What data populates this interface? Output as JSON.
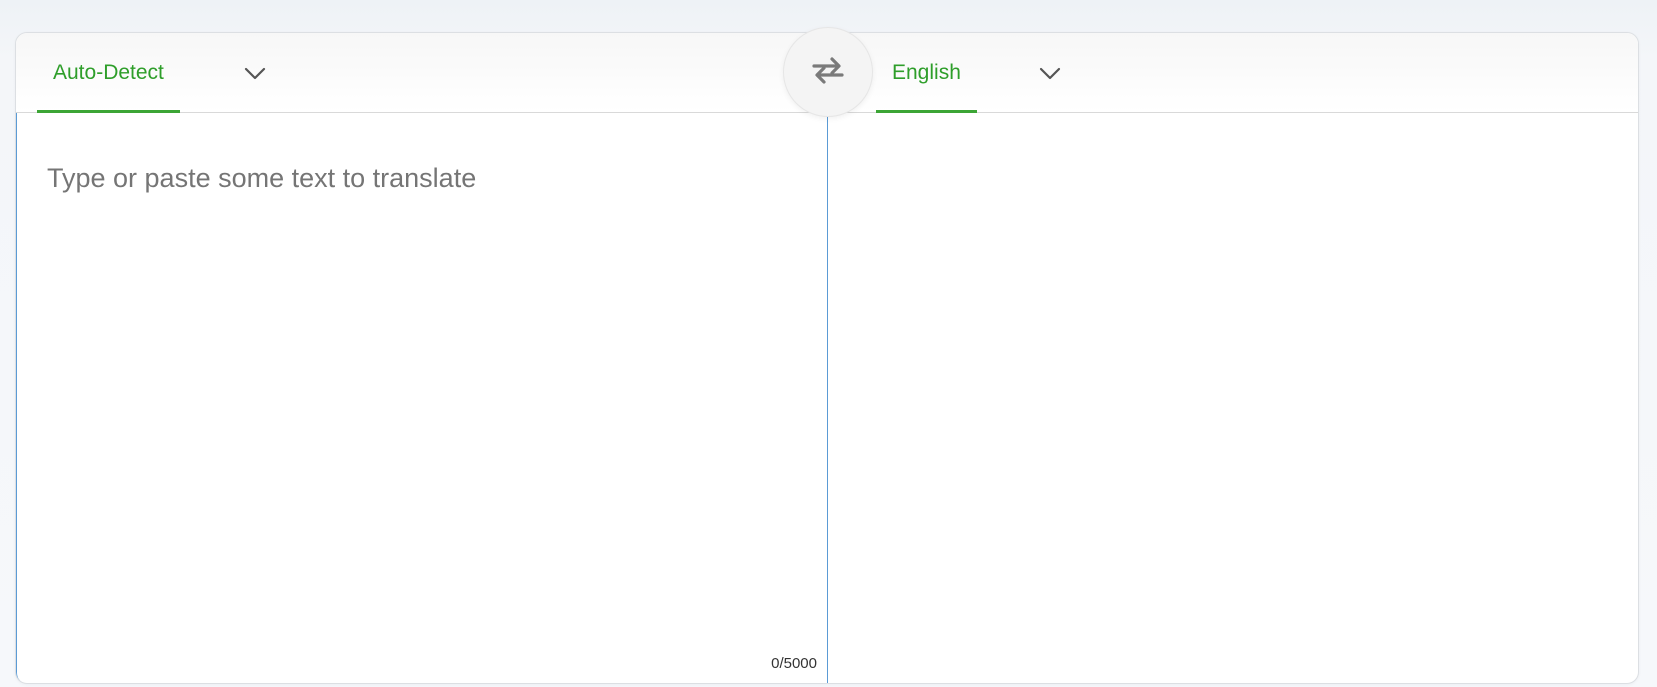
{
  "source": {
    "language": "Auto-Detect",
    "placeholder": "Type or paste some text to translate",
    "value": "",
    "char_count": "0/5000"
  },
  "target": {
    "language": "English",
    "output": ""
  },
  "icons": {
    "dropdown": "chevron-down-icon",
    "swap": "swap-arrows-icon"
  },
  "colors": {
    "accent": "#3ca535",
    "focus_border": "#5b9bd5"
  }
}
